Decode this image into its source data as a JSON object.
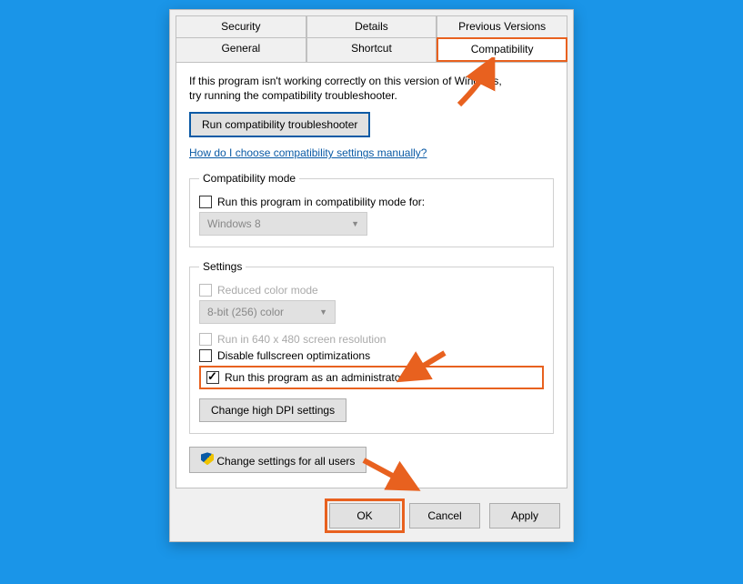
{
  "tabs": {
    "security": "Security",
    "details": "Details",
    "previous": "Previous Versions",
    "general": "General",
    "shortcut": "Shortcut",
    "compatibility": "Compatibility"
  },
  "intro": {
    "line1": "If this program isn't working correctly on this version of Windows,",
    "line2": "try running the compatibility troubleshooter."
  },
  "buttons": {
    "troubleshooter": "Run compatibility troubleshooter",
    "dpi": "Change high DPI settings",
    "allusers": "Change settings for all users",
    "ok": "OK",
    "cancel": "Cancel",
    "apply": "Apply"
  },
  "link": "How do I choose compatibility settings manually?",
  "compat_mode": {
    "legend": "Compatibility mode",
    "checkbox": "Run this program in compatibility mode for:",
    "selected": "Windows 8"
  },
  "settings": {
    "legend": "Settings",
    "reduced_color": "Reduced color mode",
    "color_selected": "8-bit (256) color",
    "lowres": "Run in 640 x 480 screen resolution",
    "fullscreen": "Disable fullscreen optimizations",
    "admin": "Run this program as an administrator"
  }
}
